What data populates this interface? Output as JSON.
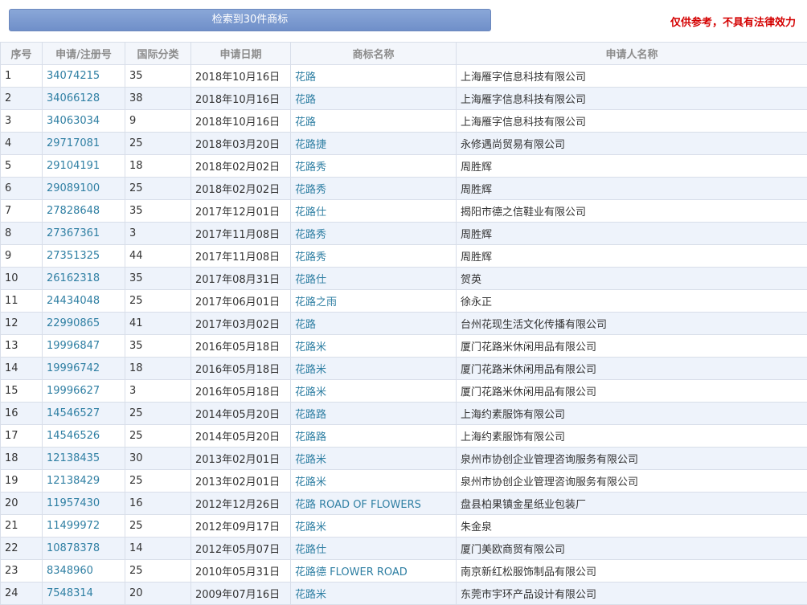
{
  "header": {
    "search_result": "检索到30件商标",
    "disclaimer": "仅供参考，不具有法律效力"
  },
  "colors": {
    "link": "#2f7fa3",
    "disclaimer": "#d40000",
    "header_button": "#7a98cf"
  },
  "table": {
    "columns": [
      "序号",
      "申请/注册号",
      "国际分类",
      "申请日期",
      "商标名称",
      "申请人名称"
    ],
    "rows": [
      {
        "no": "1",
        "reg": "34074215",
        "cls": "35",
        "date": "2018年10月16日",
        "mark": "花路",
        "applicant": "上海雁字信息科技有限公司"
      },
      {
        "no": "2",
        "reg": "34066128",
        "cls": "38",
        "date": "2018年10月16日",
        "mark": "花路",
        "applicant": "上海雁字信息科技有限公司"
      },
      {
        "no": "3",
        "reg": "34063034",
        "cls": "9",
        "date": "2018年10月16日",
        "mark": "花路",
        "applicant": "上海雁字信息科技有限公司"
      },
      {
        "no": "4",
        "reg": "29717081",
        "cls": "25",
        "date": "2018年03月20日",
        "mark": "花路捷",
        "applicant": "永修遇尚贸易有限公司"
      },
      {
        "no": "5",
        "reg": "29104191",
        "cls": "18",
        "date": "2018年02月02日",
        "mark": "花路秀",
        "applicant": "周胜辉"
      },
      {
        "no": "6",
        "reg": "29089100",
        "cls": "25",
        "date": "2018年02月02日",
        "mark": "花路秀",
        "applicant": "周胜辉"
      },
      {
        "no": "7",
        "reg": "27828648",
        "cls": "35",
        "date": "2017年12月01日",
        "mark": "花路仕",
        "applicant": "揭阳市德之信鞋业有限公司"
      },
      {
        "no": "8",
        "reg": "27367361",
        "cls": "3",
        "date": "2017年11月08日",
        "mark": "花路秀",
        "applicant": "周胜辉"
      },
      {
        "no": "9",
        "reg": "27351325",
        "cls": "44",
        "date": "2017年11月08日",
        "mark": "花路秀",
        "applicant": "周胜辉"
      },
      {
        "no": "10",
        "reg": "26162318",
        "cls": "35",
        "date": "2017年08月31日",
        "mark": "花路仕",
        "applicant": "贺英"
      },
      {
        "no": "11",
        "reg": "24434048",
        "cls": "25",
        "date": "2017年06月01日",
        "mark": "花路之雨",
        "applicant": "徐永正"
      },
      {
        "no": "12",
        "reg": "22990865",
        "cls": "41",
        "date": "2017年03月02日",
        "mark": "花路",
        "applicant": "台州花现生活文化传播有限公司"
      },
      {
        "no": "13",
        "reg": "19996847",
        "cls": "35",
        "date": "2016年05月18日",
        "mark": "花路米",
        "applicant": "厦门花路米休闲用品有限公司"
      },
      {
        "no": "14",
        "reg": "19996742",
        "cls": "18",
        "date": "2016年05月18日",
        "mark": "花路米",
        "applicant": "厦门花路米休闲用品有限公司"
      },
      {
        "no": "15",
        "reg": "19996627",
        "cls": "3",
        "date": "2016年05月18日",
        "mark": "花路米",
        "applicant": "厦门花路米休闲用品有限公司"
      },
      {
        "no": "16",
        "reg": "14546527",
        "cls": "25",
        "date": "2014年05月20日",
        "mark": "花路路",
        "applicant": "上海约素服饰有限公司"
      },
      {
        "no": "17",
        "reg": "14546526",
        "cls": "25",
        "date": "2014年05月20日",
        "mark": "花路路",
        "applicant": "上海约素服饰有限公司"
      },
      {
        "no": "18",
        "reg": "12138435",
        "cls": "30",
        "date": "2013年02月01日",
        "mark": "花路米",
        "applicant": "泉州市协创企业管理咨询服务有限公司"
      },
      {
        "no": "19",
        "reg": "12138429",
        "cls": "25",
        "date": "2013年02月01日",
        "mark": "花路米",
        "applicant": "泉州市协创企业管理咨询服务有限公司"
      },
      {
        "no": "20",
        "reg": "11957430",
        "cls": "16",
        "date": "2012年12月26日",
        "mark": "花路 ROAD OF FLOWERS",
        "applicant": "盘县柏果镇金星纸业包装厂"
      },
      {
        "no": "21",
        "reg": "11499972",
        "cls": "25",
        "date": "2012年09月17日",
        "mark": "花路米",
        "applicant": "朱金泉"
      },
      {
        "no": "22",
        "reg": "10878378",
        "cls": "14",
        "date": "2012年05月07日",
        "mark": "花路仕",
        "applicant": "厦门美欧商贸有限公司"
      },
      {
        "no": "23",
        "reg": "8348960",
        "cls": "25",
        "date": "2010年05月31日",
        "mark": "花路德 FLOWER ROAD",
        "applicant": "南京新红松服饰制品有限公司"
      },
      {
        "no": "24",
        "reg": "7548314",
        "cls": "20",
        "date": "2009年07月16日",
        "mark": "花路米",
        "applicant": "东莞市宇环产品设计有限公司"
      }
    ]
  }
}
